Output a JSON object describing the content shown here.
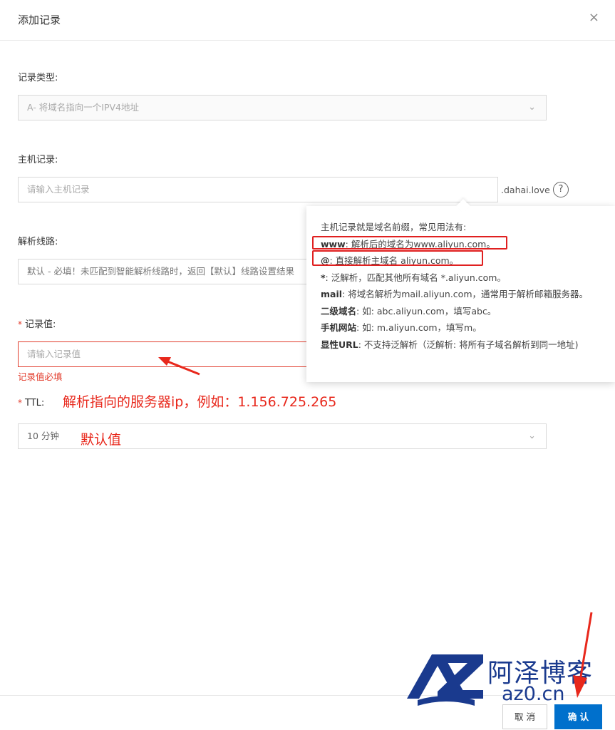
{
  "dialog": {
    "title": "添加记录",
    "close_glyph": "×"
  },
  "record_type": {
    "label": "记录类型:",
    "value": "A- 将域名指向一个IPV4地址"
  },
  "host_record": {
    "label": "主机记录:",
    "placeholder": "请输入主机记录",
    "suffix": ".dahai.love",
    "help_glyph": "?"
  },
  "resolve_line": {
    "label": "解析线路:",
    "value": "默认 - 必填！未匹配到智能解析线路时，返回【默认】线路设置结果"
  },
  "record_value": {
    "required_mark": "*",
    "label": "记录值:",
    "placeholder": "请输入记录值",
    "error": "记录值必填"
  },
  "ttl": {
    "required_mark": "*",
    "label": "TTL:",
    "value": "10 分钟"
  },
  "tooltip": {
    "title": "主机记录就是域名前缀，常见用法有:",
    "items": [
      {
        "key": "www",
        "text": ": 解析后的域名为www.aliyun.com。"
      },
      {
        "key": "@",
        "text": ": 直接解析主域名 aliyun.com。"
      },
      {
        "key": "*",
        "text": ": 泛解析，匹配其他所有域名 *.aliyun.com。"
      },
      {
        "key": "mail",
        "text": ": 将域名解析为mail.aliyun.com，通常用于解析邮箱服务器。"
      },
      {
        "key": "二级域名",
        "text": ": 如: abc.aliyun.com，填写abc。"
      },
      {
        "key": "手机网站",
        "text": ": 如: m.aliyun.com，填写m。"
      },
      {
        "key": "显性URL",
        "text": ": 不支持泛解析（泛解析: 将所有子域名解析到同一地址)"
      }
    ]
  },
  "annotations": {
    "ttl_note": "解析指向的服务器ip，例如：1.156.725.265",
    "default_note": "默认值"
  },
  "footer": {
    "cancel": "取 消",
    "confirm": "确 认"
  },
  "watermark": {
    "logo_text": "AZ",
    "name": "阿泽博客",
    "domain": "az0.cn"
  },
  "colors": {
    "accent": "#0070cc",
    "error": "#e23c2c",
    "annotation": "#e8281c",
    "watermark": "#1a3a8e"
  }
}
